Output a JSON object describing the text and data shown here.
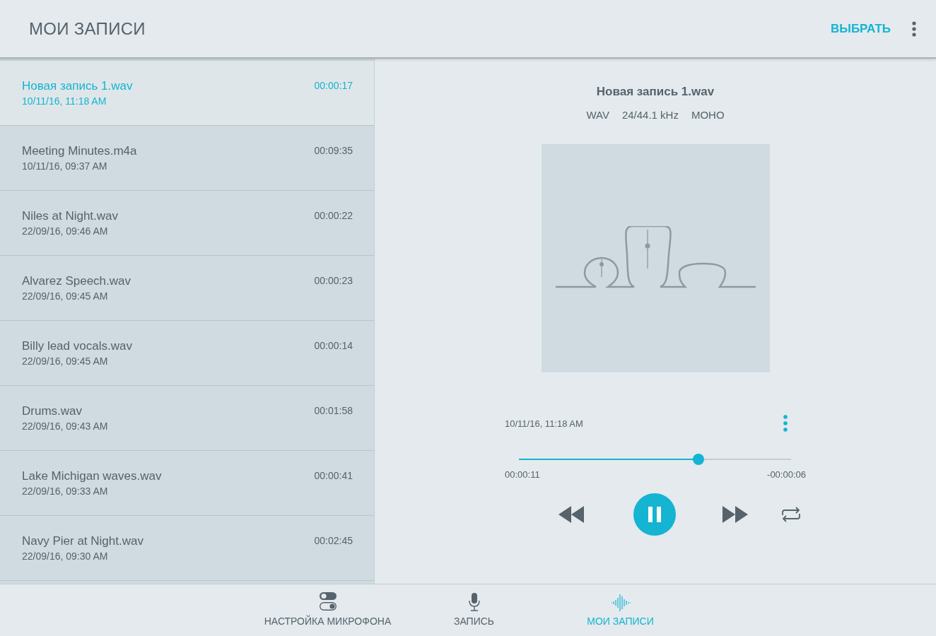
{
  "header": {
    "title": "МОИ ЗАПИСИ",
    "action": "ВЫБРАТЬ"
  },
  "recordings": [
    {
      "name": "Новая запись 1.wav",
      "date": "10/11/16, 11:18 AM",
      "duration": "00:00:17",
      "selected": true
    },
    {
      "name": "Meeting Minutes.m4a",
      "date": "10/11/16, 09:37 AM",
      "duration": "00:09:35",
      "selected": false
    },
    {
      "name": "Niles at Night.wav",
      "date": "22/09/16, 09:46 AM",
      "duration": "00:00:22",
      "selected": false
    },
    {
      "name": "Alvarez Speech.wav",
      "date": "22/09/16, 09:45 AM",
      "duration": "00:00:23",
      "selected": false
    },
    {
      "name": "Billy lead vocals.wav",
      "date": "22/09/16, 09:45 AM",
      "duration": "00:00:14",
      "selected": false
    },
    {
      "name": "Drums.wav",
      "date": "22/09/16, 09:43 AM",
      "duration": "00:01:58",
      "selected": false
    },
    {
      "name": "Lake Michigan waves.wav",
      "date": "22/09/16, 09:33 AM",
      "duration": "00:00:41",
      "selected": false
    },
    {
      "name": "Navy Pier at Night.wav",
      "date": "22/09/16, 09:30 AM",
      "duration": "00:02:45",
      "selected": false
    }
  ],
  "player": {
    "title": "Новая запись 1.wav",
    "format": [
      "WAV",
      "24/44.1 kHz",
      "МОНО"
    ],
    "date": "10/11/16, 11:18 AM",
    "level": 0.66,
    "elapsed": "00:00:11",
    "remaining": "-00:00:06",
    "playing": true
  },
  "nav": [
    {
      "label": "НАСТРОЙКА МИКРОФОНА",
      "kind": "toggles",
      "selected": false
    },
    {
      "label": "ЗАПИСЬ",
      "kind": "mic",
      "selected": false
    },
    {
      "label": "МОИ ЗАПИСИ",
      "kind": "wave",
      "selected": true
    }
  ]
}
